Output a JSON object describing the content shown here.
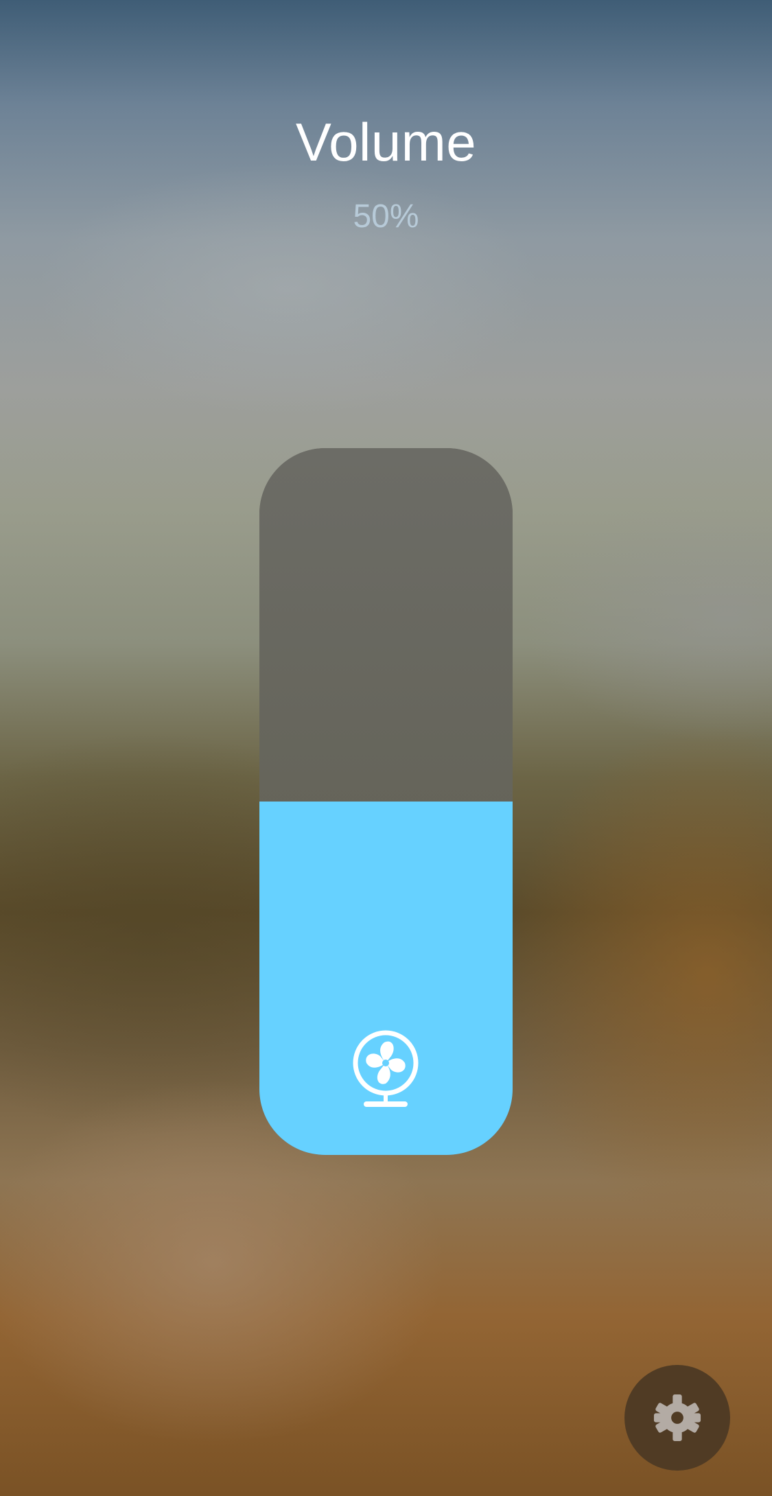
{
  "header": {
    "title": "Volume",
    "value_label": "50%"
  },
  "slider": {
    "value": 0.5,
    "fill_color": "#66d1ff",
    "track_color": "#676660",
    "icon": "fan-icon"
  },
  "settings": {
    "icon": "gear-icon",
    "button_color": "#503b24",
    "icon_color": "#b3aba4"
  }
}
